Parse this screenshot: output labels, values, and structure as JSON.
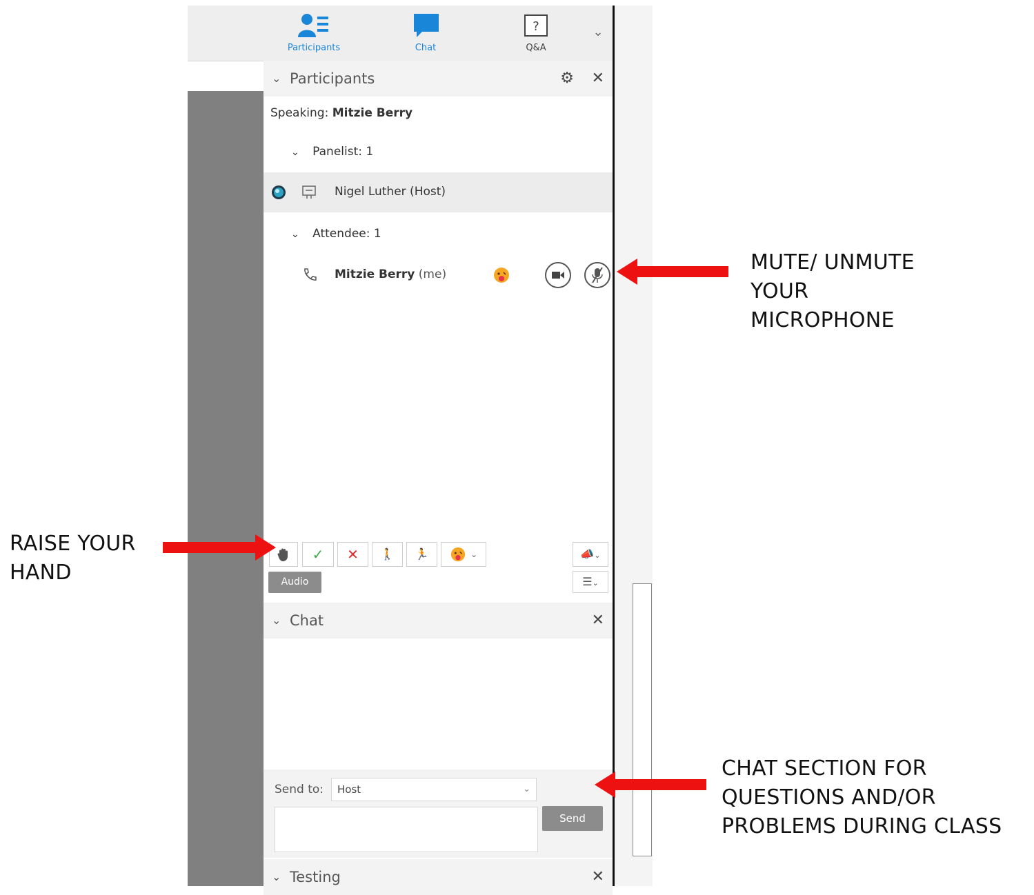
{
  "toolbar": {
    "participants_label": "Participants",
    "chat_label": "Chat",
    "qa_label": "Q&A"
  },
  "participants": {
    "header_title": "Participants",
    "speaking_prefix": "Speaking:",
    "speaking_name": "Mitzie Berry",
    "panelist_group": "Panelist: 1",
    "host_name": "Nigel Luther (Host)",
    "attendee_group": "Attendee: 1",
    "me_name": "Mitzie Berry",
    "me_suffix": "(me)"
  },
  "action_bar": {
    "audio_label": "Audio"
  },
  "chat": {
    "header_title": "Chat",
    "send_to_label": "Send to:",
    "send_to_value": "Host",
    "send_label": "Send"
  },
  "testing": {
    "header_title": "Testing"
  },
  "annotations": {
    "mute_line1": "MUTE/ UNMUTE",
    "mute_line2": "YOUR",
    "mute_line3": "MICROPHONE",
    "raise_line1": "RAISE YOUR",
    "raise_line2": "HAND",
    "chat_line1": "CHAT SECTION FOR",
    "chat_line2": "QUESTIONS AND/OR",
    "chat_line3": "PROBLEMS DURING CLASS"
  },
  "colors": {
    "accent_blue": "#1a86d8",
    "arrow_red": "#ee1111",
    "check_green": "#3aa84a",
    "cross_red": "#e02b2b"
  }
}
